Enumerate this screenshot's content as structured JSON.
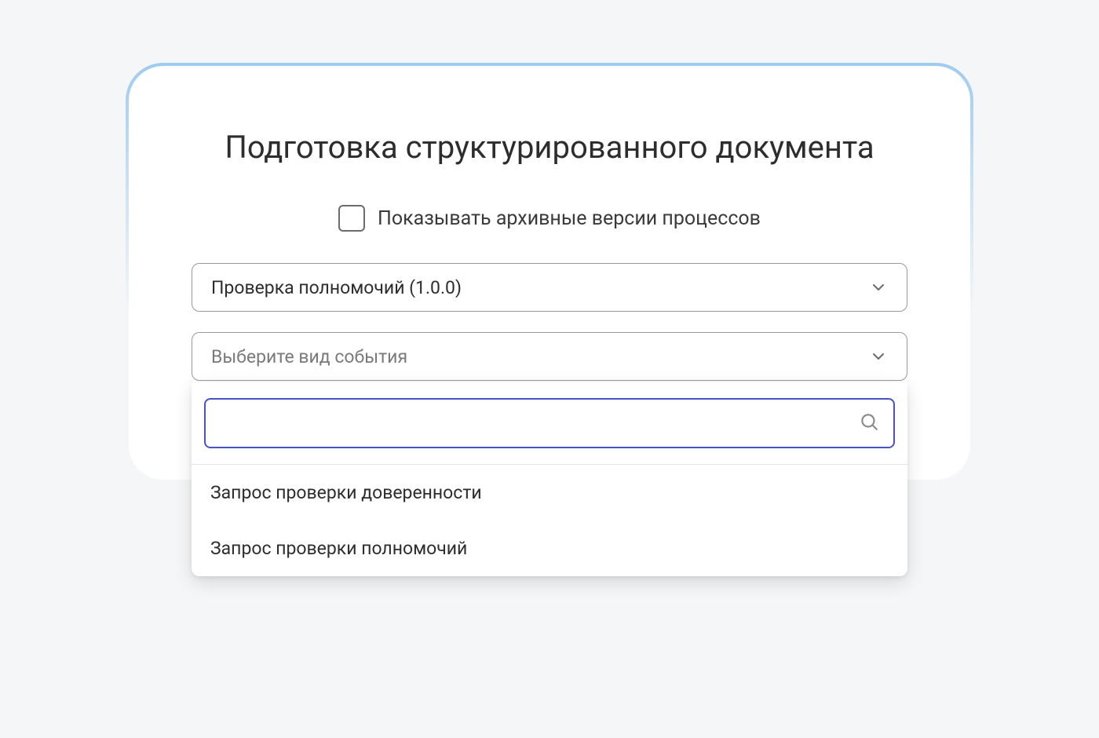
{
  "title": "Подготовка структурированного документа",
  "checkbox": {
    "label": "Показывать архивные версии процессов",
    "checked": false
  },
  "selects": {
    "process": {
      "value": "Проверка полномочий (1.0.0)"
    },
    "event": {
      "placeholder": "Выберите вид события",
      "search": "",
      "options": [
        "Запрос проверки доверенности",
        "Запрос проверки полномочий"
      ]
    }
  }
}
